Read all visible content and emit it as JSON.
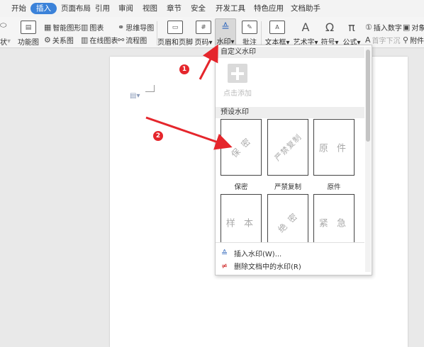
{
  "menu": [
    "开始",
    "插入",
    "页面布局",
    "引用",
    "审阅",
    "视图",
    "章节",
    "安全",
    "开发工具",
    "特色应用",
    "文档助手"
  ],
  "ribbon": {
    "shapes_partial": "状",
    "function_chart": "功能图",
    "smart_art": "智能图形",
    "relation_chart": "关系图",
    "chart": "图表",
    "online_chart": "在线图表",
    "mindmap": "思维导图",
    "flowchart": "流程图",
    "header_footer": "页眉和页脚",
    "page_number": "页码",
    "watermark": "水印",
    "comment": "批注",
    "textbox": "文本框",
    "wordart": "艺术字",
    "symbol": "符号",
    "formula": "公式",
    "insert_number": "插入数字",
    "first_drop": "首字下沉",
    "object": "对象",
    "attachment": "附件"
  },
  "watermark_panel": {
    "custom_title": "自定义水印",
    "add_label": "点击添加",
    "preset_title": "预设水印",
    "presets": [
      {
        "text": "保 密",
        "caption": "保密"
      },
      {
        "text": "严禁复制",
        "caption": "严禁复制"
      },
      {
        "text": "原 件",
        "caption": "原件"
      },
      {
        "text": "样 本",
        "caption": ""
      },
      {
        "text": "绝 密",
        "caption": ""
      },
      {
        "text": "紧 急",
        "caption": ""
      }
    ],
    "insert_label": "插入水印(W)...",
    "delete_label": "删除文档中的水印(R)"
  },
  "callouts": [
    "1",
    "2"
  ],
  "colors": {
    "accent": "#3b82d9",
    "arrow": "#e5262c"
  }
}
